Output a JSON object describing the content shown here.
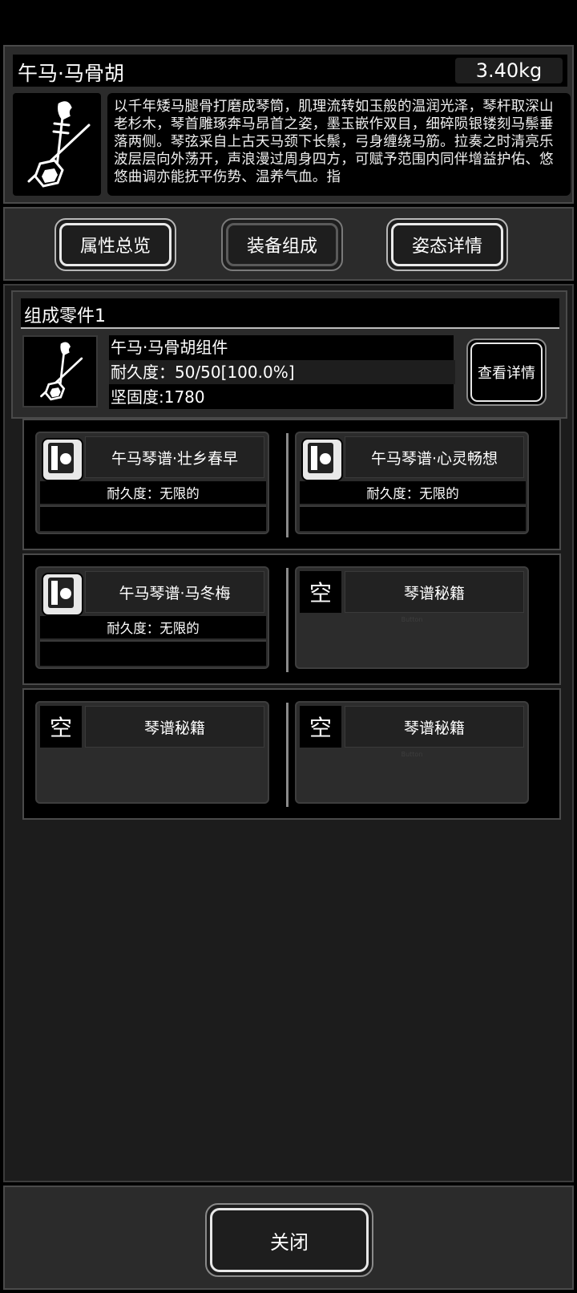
{
  "item": {
    "title": "午马·马骨胡",
    "weight": "3.40kg",
    "icon": "erhu-horsehead-icon",
    "description": "以千年矮马腿骨打磨成琴筒，肌理流转如玉般的温润光泽，琴杆取深山老杉木，琴首雕琢奔马昂首之姿，墨玉嵌作双目，细碎陨银镂刻马鬃垂落两侧。琴弦采自上古天马颈下长鬃，弓身缠绕马筋。拉奏之时清亮乐波层层向外荡开，声浪漫过周身四方，可赋予范围内同伴增益护佑、悠悠曲调亦能抚平伤势、温养气血。指"
  },
  "tabs": [
    {
      "label": "属性总览"
    },
    {
      "label": "装备组成"
    },
    {
      "label": "姿态详情"
    }
  ],
  "component": {
    "section_title": "组成零件1",
    "name": "午马·马骨胡组件",
    "durability": "耐久度：50/50[100.0%]",
    "hardness": "坚固度:1780",
    "detail_button": "查看详情"
  },
  "slots": [
    {
      "name": "午马琴谱·壮乡春早",
      "durability": "耐久度：无限的",
      "icon": "score-book-icon"
    },
    {
      "name": "午马琴谱·心灵畅想",
      "durability": "耐久度：无限的",
      "icon": "score-book-icon"
    },
    {
      "name": "午马琴谱·马冬梅",
      "durability": "耐久度：无限的",
      "icon": "score-book-icon"
    },
    {
      "empty_label": "空",
      "name": "琴谱秘籍",
      "ghost": "Button"
    },
    {
      "empty_label": "空",
      "name": "琴谱秘籍"
    },
    {
      "empty_label": "空",
      "name": "琴谱秘籍",
      "ghost": "Button"
    }
  ],
  "footer": {
    "close_label": "关闭"
  },
  "colors": {
    "background": "#000000",
    "panel": "#2b2b2b",
    "border": "#4a4a4a",
    "text": "#ffffff"
  }
}
